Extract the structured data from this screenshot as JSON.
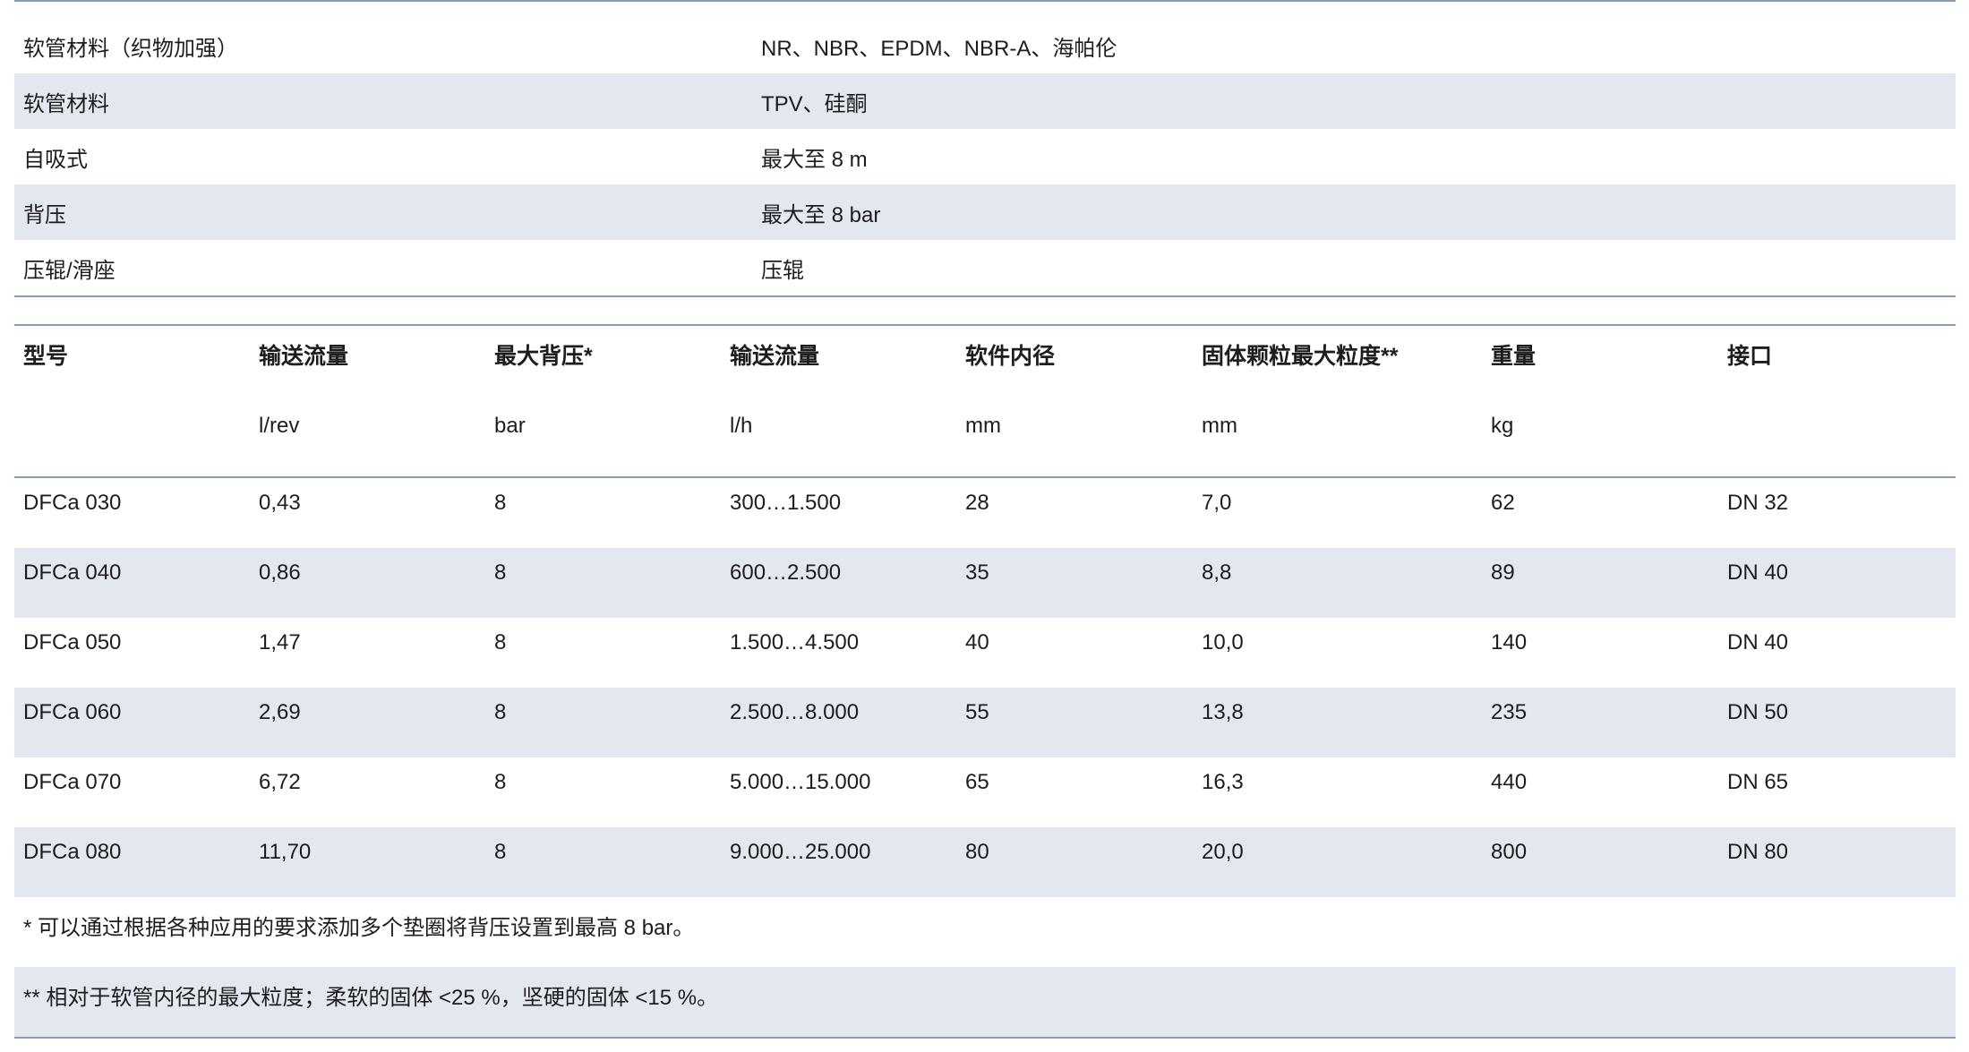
{
  "spec_rows": [
    {
      "label": "软管材料（织物加强）",
      "value": "NR、NBR、EPDM、NBR-A、海帕伦"
    },
    {
      "label": "软管材料",
      "value": "TPV、硅酮"
    },
    {
      "label": "自吸式",
      "value": "最大至 8 m"
    },
    {
      "label": "背压",
      "value": "最大至 8 bar"
    },
    {
      "label": "压辊/滑座",
      "value": "压辊"
    }
  ],
  "table": {
    "columns": [
      {
        "name": "型号",
        "unit": ""
      },
      {
        "name": "输送流量",
        "unit": "l/rev"
      },
      {
        "name": "最大背压*",
        "unit": "bar"
      },
      {
        "name": "输送流量",
        "unit": "l/h"
      },
      {
        "name": "软件内径",
        "unit": "mm"
      },
      {
        "name": "固体颗粒最大粒度**",
        "unit": "mm"
      },
      {
        "name": "重量",
        "unit": "kg"
      },
      {
        "name": "接口",
        "unit": ""
      }
    ],
    "rows": [
      [
        "DFCa 030",
        "0,43",
        "8",
        "300…1.500",
        "28",
        "7,0",
        "62",
        "DN 32"
      ],
      [
        "DFCa 040",
        "0,86",
        "8",
        "600…2.500",
        "35",
        "8,8",
        "89",
        "DN 40"
      ],
      [
        "DFCa 050",
        "1,47",
        "8",
        "1.500…4.500",
        "40",
        "10,0",
        "140",
        "DN 40"
      ],
      [
        "DFCa 060",
        "2,69",
        "8",
        "2.500…8.000",
        "55",
        "13,8",
        "235",
        "DN 50"
      ],
      [
        "DFCa 070",
        "6,72",
        "8",
        "5.000…15.000",
        "65",
        "16,3",
        "440",
        "DN 65"
      ],
      [
        "DFCa 080",
        "11,70",
        "8",
        "9.000…25.000",
        "80",
        "20,0",
        "800",
        "DN 80"
      ]
    ]
  },
  "notes": [
    "* 可以通过根据各种应用的要求添加多个垫圈将背压设置到最高 8 bar。",
    "** 相对于软管内径的最大粒度；柔软的固体 <25 %，坚硬的固体 <15 %。"
  ],
  "colors": {
    "row_shade": "#e2e7f0",
    "rule": "#8a9bb4"
  }
}
